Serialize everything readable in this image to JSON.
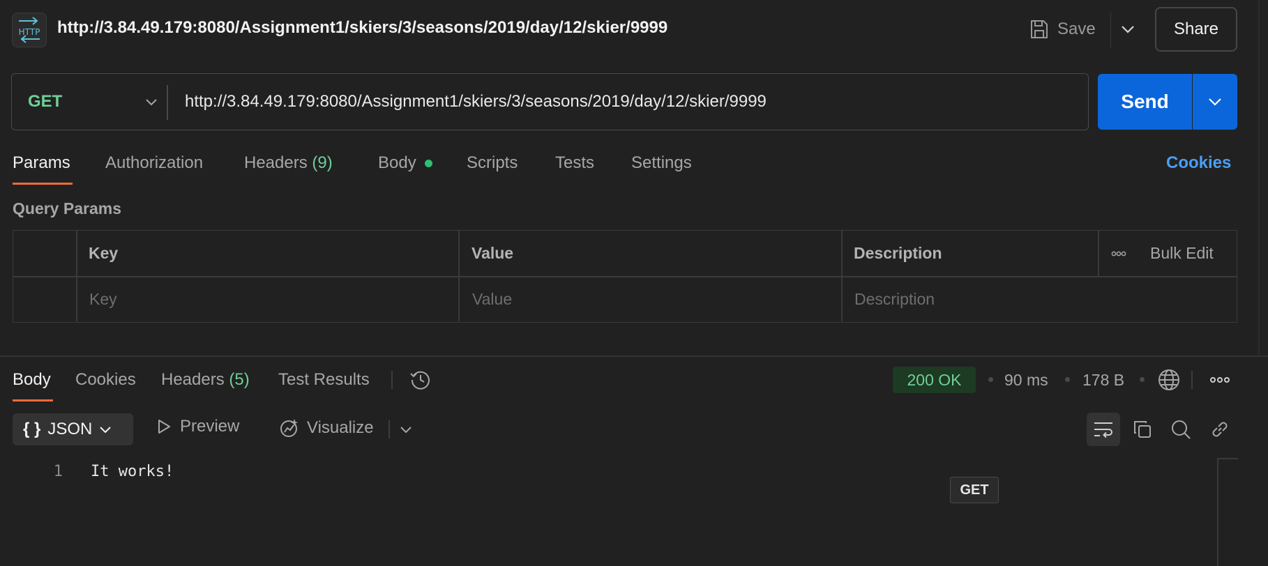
{
  "header": {
    "badge_text": "HTTP",
    "title": "http://3.84.49.179:8080/Assignment1/skiers/3/seasons/2019/day/12/skier/9999",
    "save_label": "Save",
    "share_label": "Share"
  },
  "request": {
    "method": "GET",
    "url": "http://3.84.49.179:8080/Assignment1/skiers/3/seasons/2019/day/12/skier/9999",
    "send_label": "Send"
  },
  "request_tabs": {
    "params": "Params",
    "authorization": "Authorization",
    "headers": "Headers",
    "headers_count": "(9)",
    "body": "Body",
    "scripts": "Scripts",
    "tests": "Tests",
    "settings": "Settings",
    "cookies": "Cookies"
  },
  "query_params": {
    "section_label": "Query Params",
    "columns": [
      "Key",
      "Value",
      "Description"
    ],
    "bulk_edit_label": "Bulk Edit",
    "placeholders": [
      "Key",
      "Value",
      "Description"
    ]
  },
  "response_tabs": {
    "body": "Body",
    "cookies": "Cookies",
    "headers": "Headers",
    "headers_count": "(5)",
    "test_results": "Test Results"
  },
  "response_meta": {
    "status": "200 OK",
    "time": "90 ms",
    "size": "178 B"
  },
  "body_toolbar": {
    "format_icon": "{ }",
    "format": "JSON",
    "preview_label": "Preview",
    "visualize_label": "Visualize"
  },
  "editor": {
    "line_number": "1",
    "line_text": "It works!"
  },
  "tooltip": "GET",
  "colors": {
    "accent_orange": "#f26b3a",
    "send_blue": "#0b66db",
    "method_green": "#6fcf97",
    "link_blue": "#4a9ff5"
  },
  "icons": [
    "http-icon",
    "save-icon",
    "chevron-down-icon",
    "history-icon",
    "globe-icon",
    "more-icon",
    "play-icon",
    "visualize-icon",
    "wrap-icon",
    "copy-icon",
    "search-icon",
    "link-icon"
  ]
}
